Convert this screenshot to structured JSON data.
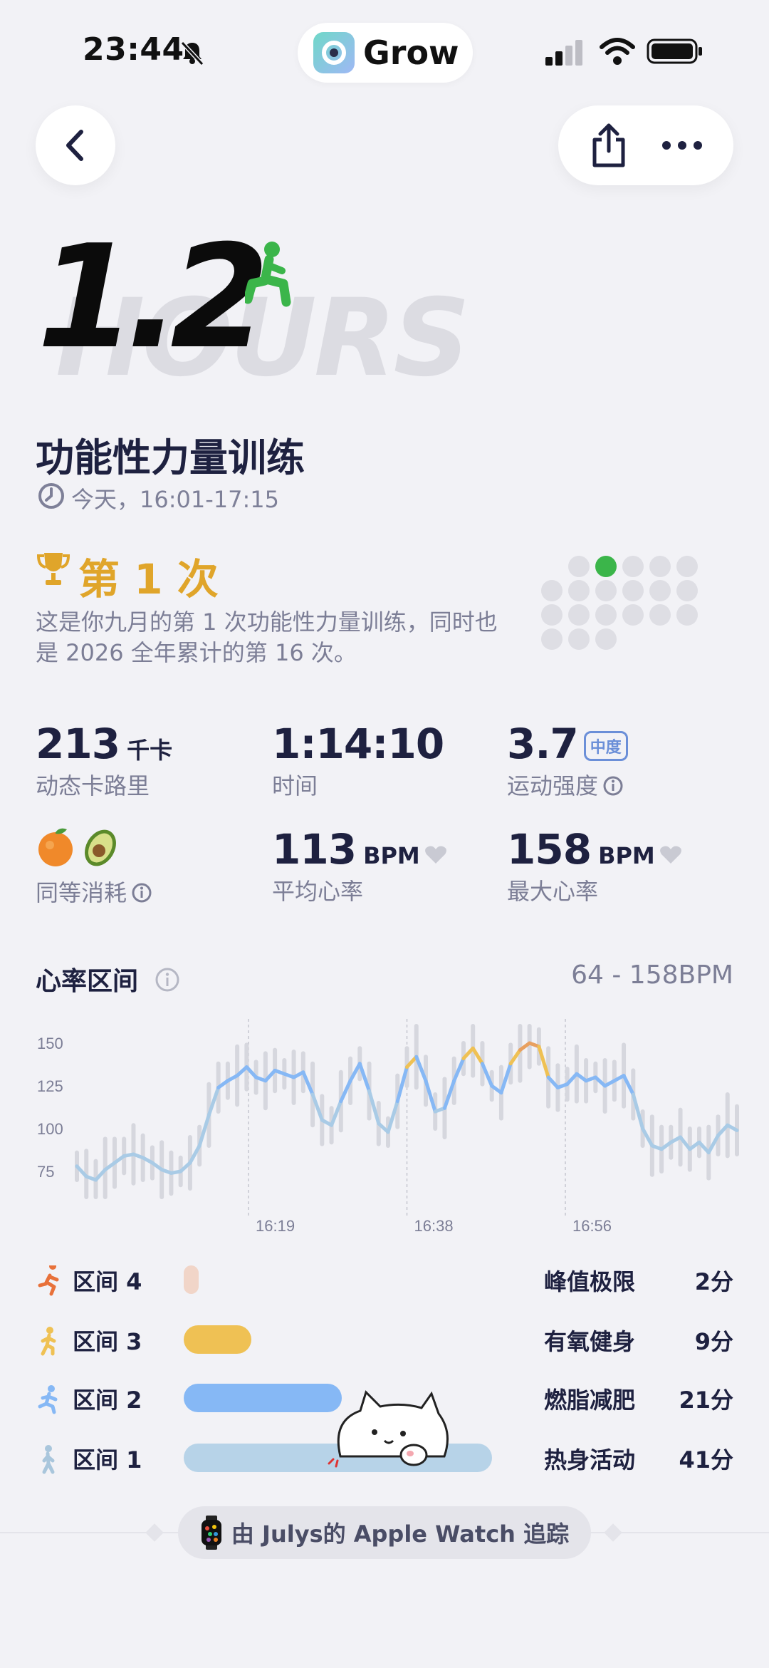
{
  "status_bar": {
    "time": "23:44",
    "app_name": "Grow"
  },
  "hero": {
    "value": "1.2",
    "unit_watermark": "HOURS",
    "title": "功能性力量训练",
    "time_range": "今天，16:01-17:15",
    "workout_icon": "lunge-icon"
  },
  "achievement": {
    "title": "第 1 次",
    "description": "这是你九月的第 1 次功能性力量训练，同时也是 2026 全年累计的第 16 次。",
    "dots_total": 23,
    "highlighted_dot": 2,
    "colors": {
      "highlight": "#3bb54a",
      "accent": "#e0a52a"
    }
  },
  "stats": {
    "calories": {
      "value": "213",
      "unit": "千卡",
      "label": "动态卡路里"
    },
    "duration": {
      "value": "1:14:10",
      "label": "时间"
    },
    "intensity": {
      "value": "3.7",
      "badge": "中度",
      "label": "运动强度"
    },
    "equivalent": {
      "label": "同等消耗",
      "icons": [
        "orange-icon",
        "avocado-icon"
      ]
    },
    "avg_hr": {
      "value": "113",
      "unit": "BPM",
      "label": "平均心率"
    },
    "max_hr": {
      "value": "158",
      "unit": "BPM",
      "label": "最大心率"
    }
  },
  "heart_rate": {
    "title": "心率区间",
    "range": "64 - 158BPM"
  },
  "chart_data": {
    "type": "line",
    "title": "",
    "xlabel": "",
    "ylabel": "",
    "ylim": [
      60,
      160
    ],
    "y_ticks": [
      "150",
      "125",
      "100",
      "75"
    ],
    "x_ticks": [
      "16:19",
      "16:38",
      "16:56"
    ],
    "series": [
      {
        "values": [
          78,
          72,
          70,
          76,
          80,
          84,
          85,
          83,
          80,
          76,
          74,
          75,
          80,
          90,
          108,
          124,
          128,
          131,
          136,
          130,
          128,
          134,
          132,
          130,
          133,
          120,
          105,
          102,
          116,
          128,
          138,
          122,
          103,
          98,
          116,
          136,
          142,
          128,
          110,
          112,
          128,
          141,
          147,
          138,
          125,
          121,
          138,
          146,
          150,
          148,
          130,
          124,
          126,
          132,
          128,
          130,
          125,
          128,
          131,
          120,
          100,
          90,
          88,
          92,
          95,
          88,
          92,
          86,
          96,
          102,
          99
        ]
      }
    ]
  },
  "zones": [
    {
      "label": "区间 4",
      "name": "峰值极限",
      "duration": "2分",
      "minutes": 2,
      "color": "#f1d5c8",
      "icon": "sprint-icon"
    },
    {
      "label": "区间 3",
      "name": "有氧健身",
      "duration": "9分",
      "minutes": 9,
      "color": "#efc154",
      "icon": "jog-icon"
    },
    {
      "label": "区间 2",
      "name": "燃脂减肥",
      "duration": "21分",
      "minutes": 21,
      "color": "#86b8f5",
      "icon": "run-icon"
    },
    {
      "label": "区间 1",
      "name": "热身活动",
      "duration": "41分",
      "minutes": 41,
      "color": "#b7d3e8",
      "icon": "walk-icon"
    }
  ],
  "footer": {
    "text": "由 Julys的 Apple Watch 追踪"
  }
}
